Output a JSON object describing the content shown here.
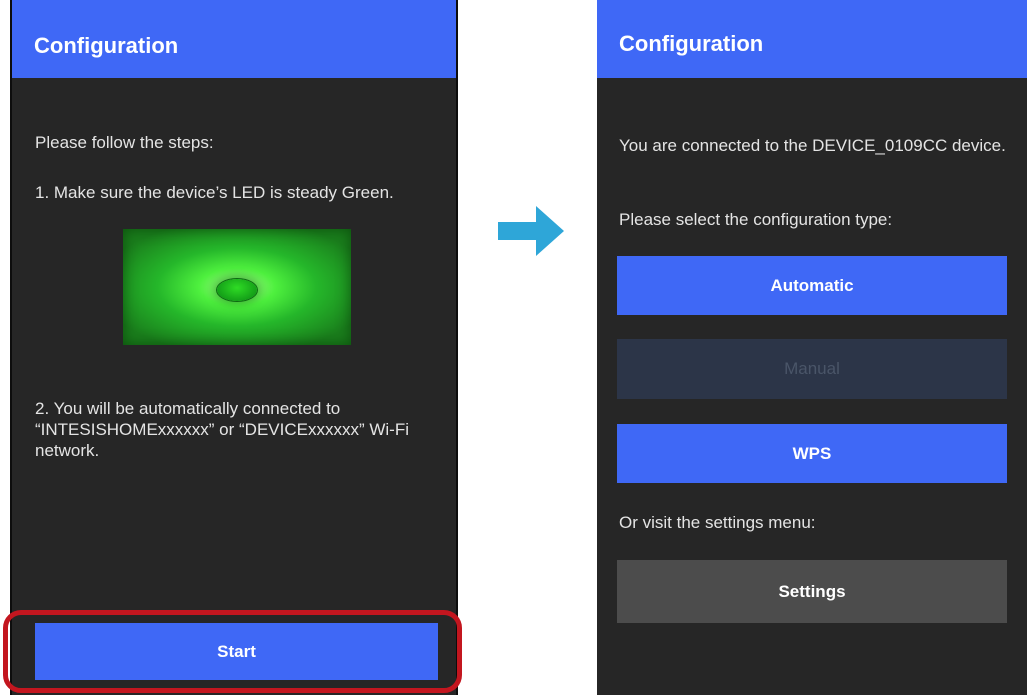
{
  "left_screen": {
    "title": "Configuration",
    "intro": "Please follow the steps:",
    "step1": "1. Make sure the device’s LED is steady Green.",
    "step2": "2. You will be automatically connected to “INTESISHOMExxxxxx” or “DEVICExxxxxx” Wi-Fi network.",
    "start_label": "Start"
  },
  "right_screen": {
    "title": "Configuration",
    "connected_text": "You are connected to the DEVICE_0109CC device.",
    "select_text": "Please select the configuration type:",
    "automatic_label": "Automatic",
    "manual_label": "Manual",
    "wps_label": "WPS",
    "visit_text": "Or visit the settings menu:",
    "settings_label": "Settings"
  },
  "colors": {
    "accent": "#3f68f6",
    "background": "#262626",
    "disabled_button": "#2c3548",
    "settings_button": "#4c4c4c",
    "highlight": "#c3161f",
    "arrow": "#2ea6d8",
    "led": "#2fdc25"
  },
  "icons": {
    "arrow": "arrow-right-icon",
    "led": "led-icon"
  }
}
